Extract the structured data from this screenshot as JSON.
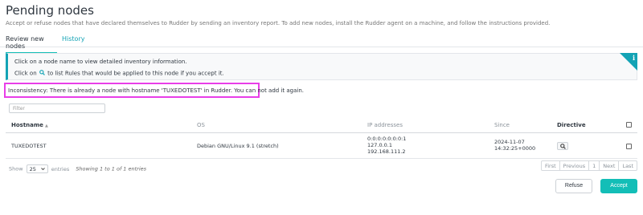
{
  "header": {
    "title": "Pending nodes",
    "description": "Accept or refuse nodes that have declared themselves to Rudder by sending an inventory report. To add new nodes, install the Rudder agent on a machine, and follow the instructions provided."
  },
  "tabs": {
    "review": "Review new nodes",
    "history": "History"
  },
  "info": {
    "line1": "Click on a node name to view detailed inventory information.",
    "line2_prefix": "Click on",
    "line2_suffix": "to list Rules that would be applied to this node if you accept it.",
    "icon": "info-icon"
  },
  "warning": {
    "text": "Inconsistency: There is already a node with hostname 'TUXEDOTEST' in Rudder. You can not add it again."
  },
  "filter": {
    "placeholder": "Filter"
  },
  "table": {
    "columns": {
      "hostname": "Hostname",
      "os": "OS",
      "ip": "IP addresses",
      "since": "Since",
      "directive": "Directive"
    },
    "rows": [
      {
        "hostname": "TUXEDOTEST",
        "os": "Debian GNU/Linux 9.1 (stretch)",
        "ip1": "0:0:0:0:0:0:0:1",
        "ip2": "127.0.0.1",
        "ip3": "192.168.111.2",
        "since_date": "2024-11-07",
        "since_time": "14:32:25+0000"
      }
    ]
  },
  "footer": {
    "show": "Show",
    "page_size": "25",
    "entries": "entries",
    "showing": "Showing 1 to 1 of 1 entries",
    "pagination": {
      "first": "First",
      "previous": "Previous",
      "current": "1",
      "next": "Next",
      "last": "Last"
    }
  },
  "actions": {
    "refuse": "Refuse",
    "accept": "Accept"
  },
  "colors": {
    "accent": "#13beb7",
    "info_border": "#13a3b5",
    "warning_highlight": "#e83ee8"
  }
}
